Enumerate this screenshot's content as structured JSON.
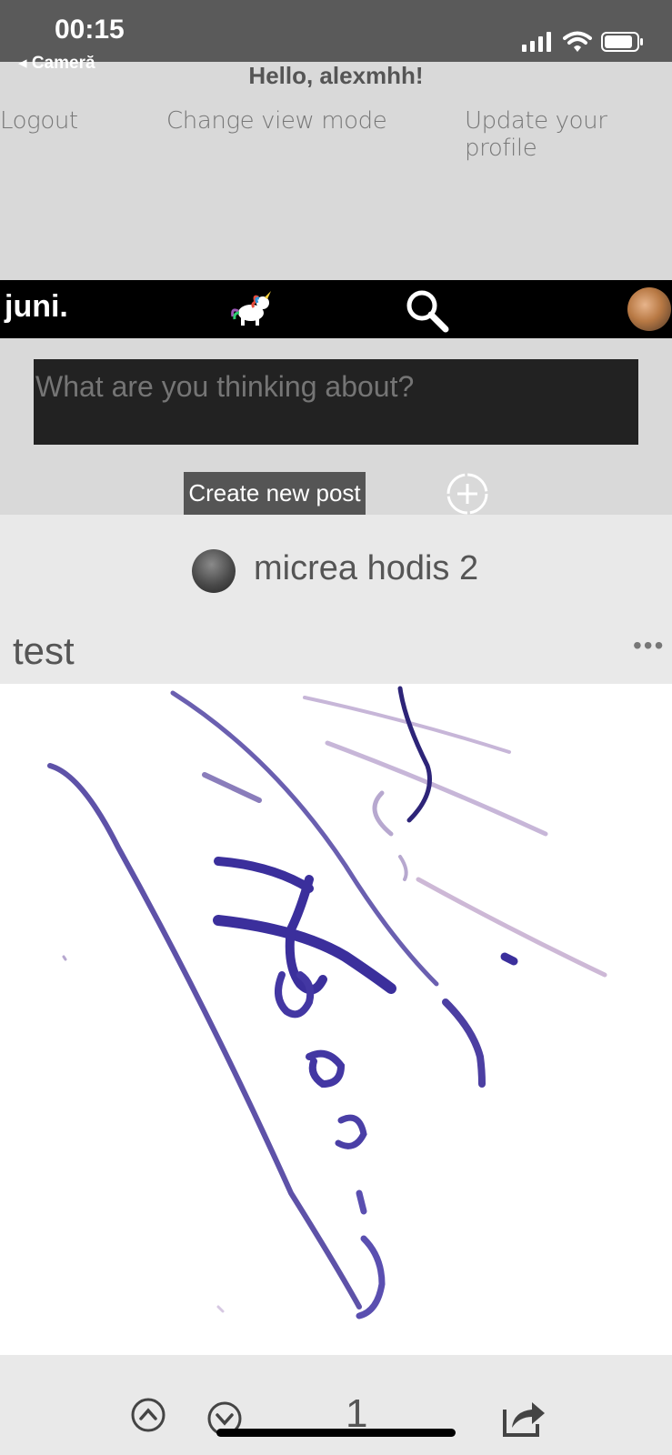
{
  "status_bar": {
    "time": "00:15",
    "back_app": "◂ Cameră",
    "icons": [
      "signal-icon",
      "wifi-icon",
      "battery-icon"
    ]
  },
  "header": {
    "greeting": "Hello, alexmhh!",
    "links": [
      "Logout",
      "Change view mode",
      "Update your profile"
    ]
  },
  "app_bar": {
    "brand": "juni.",
    "icons": [
      "unicorn-icon",
      "search-icon",
      "user-avatar"
    ]
  },
  "composer": {
    "placeholder": "What are you thinking about?",
    "create_button": "Create new post"
  },
  "post": {
    "author": "micrea hodis 2",
    "title": "test",
    "menu": "•••",
    "image": "handwritten signature",
    "votes": "1"
  },
  "colors": {
    "status_bar": "#5a5a5a",
    "background": "#d9d9d9",
    "app_bar": "#000000",
    "composer": "#222222",
    "button": "#555555",
    "post_bg": "#e9e9e9",
    "ink": "#3d2f9a"
  }
}
